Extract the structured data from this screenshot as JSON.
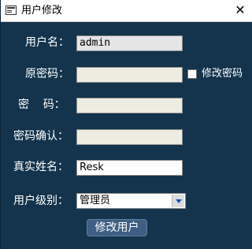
{
  "window": {
    "title": "用户修改",
    "close_glyph": "✕"
  },
  "form": {
    "username": {
      "label": "用户名：",
      "value": "admin"
    },
    "old_password": {
      "label": "原密码：",
      "value": ""
    },
    "change_password": {
      "label": "修改密码",
      "checked": false
    },
    "password": {
      "label": "密    码：",
      "value": ""
    },
    "confirm_password": {
      "label": "密码确认：",
      "value": ""
    },
    "real_name": {
      "label": "真实姓名：",
      "value": "Resk"
    },
    "user_level": {
      "label": "用户级别：",
      "selected": "管理员"
    },
    "submit_label": "修改用户"
  },
  "colors": {
    "background": "#13344c",
    "button": "#3e5f83",
    "field": "#eeebe0"
  },
  "icons": {
    "app": "form-icon",
    "close": "close-icon",
    "dropdown": "chevron-down-icon"
  }
}
